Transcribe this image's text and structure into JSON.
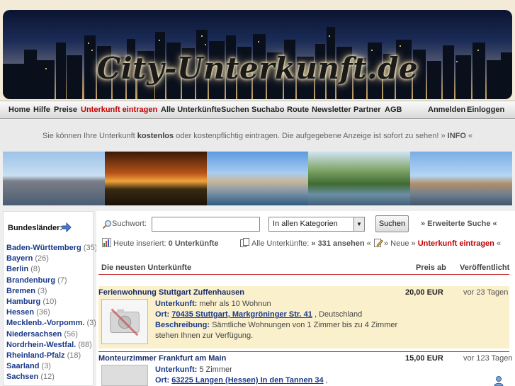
{
  "site": {
    "logo_text": "City-Unterkunft.de"
  },
  "nav": {
    "items": [
      "Home",
      "Hilfe",
      "Preise",
      "Unterkunft eintragen",
      "Alle Unterkünfte",
      "Suchen",
      "Suchabo",
      "Route",
      "Newsletter",
      "Partner",
      "AGB"
    ],
    "right": [
      "Anmelden",
      "Einloggen"
    ],
    "highlight_color": "#c40000"
  },
  "infobar": {
    "pre": "Sie können Ihre Unterkunft ",
    "bold": "kostenlos",
    "post": " oder kostenpflichtig eintragen. Die aufgegebene Anzeige ist sofort zu sehen! » ",
    "info": "INFO",
    "tail": " «"
  },
  "sidebar": {
    "title": "Bundesländer:",
    "states": [
      {
        "name": "Baden-Württemberg",
        "count": "(35)"
      },
      {
        "name": "Bayern",
        "count": "(26)"
      },
      {
        "name": "Berlin",
        "count": "(8)"
      },
      {
        "name": "Brandenburg",
        "count": "(7)"
      },
      {
        "name": "Bremen",
        "count": "(3)"
      },
      {
        "name": "Hamburg",
        "count": "(10)"
      },
      {
        "name": "Hessen",
        "count": "(36)"
      },
      {
        "name": "Mecklenb.-Vorpomm.",
        "count": "(3)"
      },
      {
        "name": "Niedersachsen",
        "count": "(56)"
      },
      {
        "name": "Nordrhein-Westfal.",
        "count": "(88)"
      },
      {
        "name": "Rheinland-Pfalz",
        "count": "(18)"
      },
      {
        "name": "Saarland",
        "count": "(3)"
      },
      {
        "name": "Sachsen",
        "count": "(12)"
      }
    ]
  },
  "search": {
    "label": "Suchwort:",
    "value": "",
    "category": "In allen Kategorien",
    "button": "Suchen",
    "advanced": "» Erweiterte Suche «"
  },
  "stats": {
    "today_label": "Heute inseriert:",
    "today_value": "0 Unterkünfte",
    "all_label": "Alle Unterkünfte:",
    "all_link": "» 331 ansehen",
    "all_tail": "«",
    "new_label": "» Neue »",
    "new_link": "Unterkunft eintragen",
    "new_tail": "«"
  },
  "list": {
    "headers": {
      "title": "Die neusten Unterkünfte",
      "price": "Preis ab",
      "published": "Veröffentlicht"
    },
    "items": [
      {
        "title": "Ferienwohnung Stuttgart Zuffenhausen",
        "price": "20,00 EUR",
        "published": "vor 23 Tagen",
        "unterkunft_label": "Unterkunft:",
        "unterkunft": "mehr als 10 Wohnun",
        "ort_label": "Ort:",
        "ort_link": "70435 Stuttgart, Markgröninger Str. 41",
        "ort_tail": " , Deutschland",
        "beschreibung_label": "Beschreibung:",
        "beschreibung": "Sämtliche Wohnungen von 1 Zimmer bis zu 4 Zimmer stehen Ihnen zur Verfügung."
      },
      {
        "title": "Monteurzimmer Frankfurt am Main",
        "price": "15,00 EUR",
        "published": "vor 123 Tagen",
        "unterkunft_label": "Unterkunft:",
        "unterkunft": "5 Zimmer",
        "ort_label": "Ort:",
        "ort_link": "63225 Langen (Hessen) In den Tannen 34",
        "ort_tail": " ,"
      }
    ]
  }
}
